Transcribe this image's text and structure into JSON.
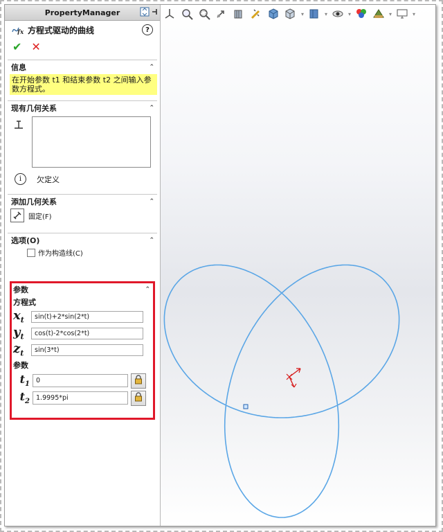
{
  "panel_header": "PropertyManager",
  "feature_title": "方程式驱动的曲线",
  "help_label": "?",
  "ok_symbol": "✔",
  "cancel_symbol": "✕",
  "sections": {
    "info": {
      "title": "信息",
      "message": "在开始参数 t1 和结束参数 t2 之间输入参数方程式。"
    },
    "existing_relations": {
      "title": "现有几何关系",
      "status": "欠定义"
    },
    "add_relations": {
      "title": "添加几何关系",
      "fix_label": "固定(F)"
    },
    "options": {
      "title": "选项(O)",
      "construction_label": "作为构造线(C)"
    },
    "parameters": {
      "title": "参数",
      "equations_label": "方程式",
      "x": {
        "var": "x",
        "sub": "t",
        "value": "sin(t)+2*sin(2*t)"
      },
      "y": {
        "var": "y",
        "sub": "t",
        "value": "cos(t)-2*cos(2*t)"
      },
      "z": {
        "var": "z",
        "sub": "t",
        "value": "sin(3*t)"
      },
      "params_label": "参数",
      "t1": {
        "var": "t",
        "sub": "1",
        "value": "0"
      },
      "t2": {
        "var": "t",
        "sub": "2",
        "value": "1.9995*pi"
      }
    }
  },
  "toolbar_icons": [
    "view-orientation-icon",
    "zoom-to-fit-icon",
    "zoom-to-area-icon",
    "previous-view-icon",
    "section-view-icon",
    "dynamic-annotation-icon",
    "view-cube-icon",
    "display-style-icon",
    "hide-show-icon",
    "edit-appearance-icon",
    "apply-scene-icon",
    "view-settings-icon",
    "monitor-icon"
  ],
  "colors": {
    "curve": "#5aa6e6",
    "highlight_border": "#e0182a",
    "info_bg": "#ffff80",
    "triad": "#d61a1a"
  }
}
